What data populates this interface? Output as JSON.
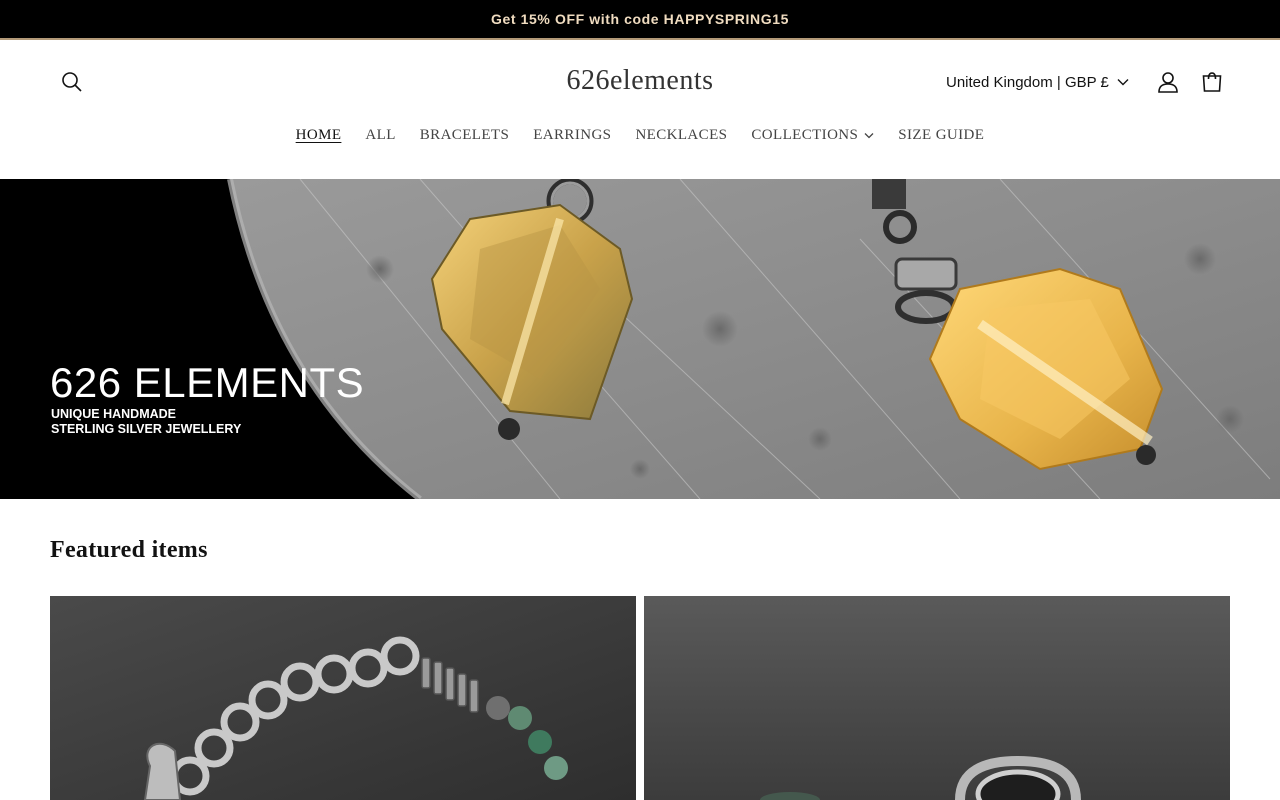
{
  "announcement": {
    "text": "Get 15% OFF with code HAPPYSPRING15"
  },
  "header": {
    "logo": "626elements",
    "country_selector": "United Kingdom | GBP £",
    "icons": {
      "search": "search-icon",
      "account": "account-icon",
      "cart": "cart-icon",
      "country_dropdown": "chevron-down-icon"
    }
  },
  "nav": {
    "items": [
      {
        "label": "HOME",
        "active": true
      },
      {
        "label": "ALL"
      },
      {
        "label": "BRACELETS"
      },
      {
        "label": "EARRINGS"
      },
      {
        "label": "NECKLACES"
      },
      {
        "label": "COLLECTIONS",
        "has_dropdown": true
      },
      {
        "label": "SIZE GUIDE"
      }
    ]
  },
  "hero": {
    "title": "626 ELEMENTS",
    "subtitle_line1": "UNIQUE HANDMADE",
    "subtitle_line2": "STERLING SILVER JEWELLERY"
  },
  "featured": {
    "title": "Featured items"
  },
  "colors": {
    "announcement_bg": "#000000",
    "announcement_text": "#f0dcc0",
    "citrine": "#e8b44a",
    "stone_grey": "#8a8a8a"
  }
}
